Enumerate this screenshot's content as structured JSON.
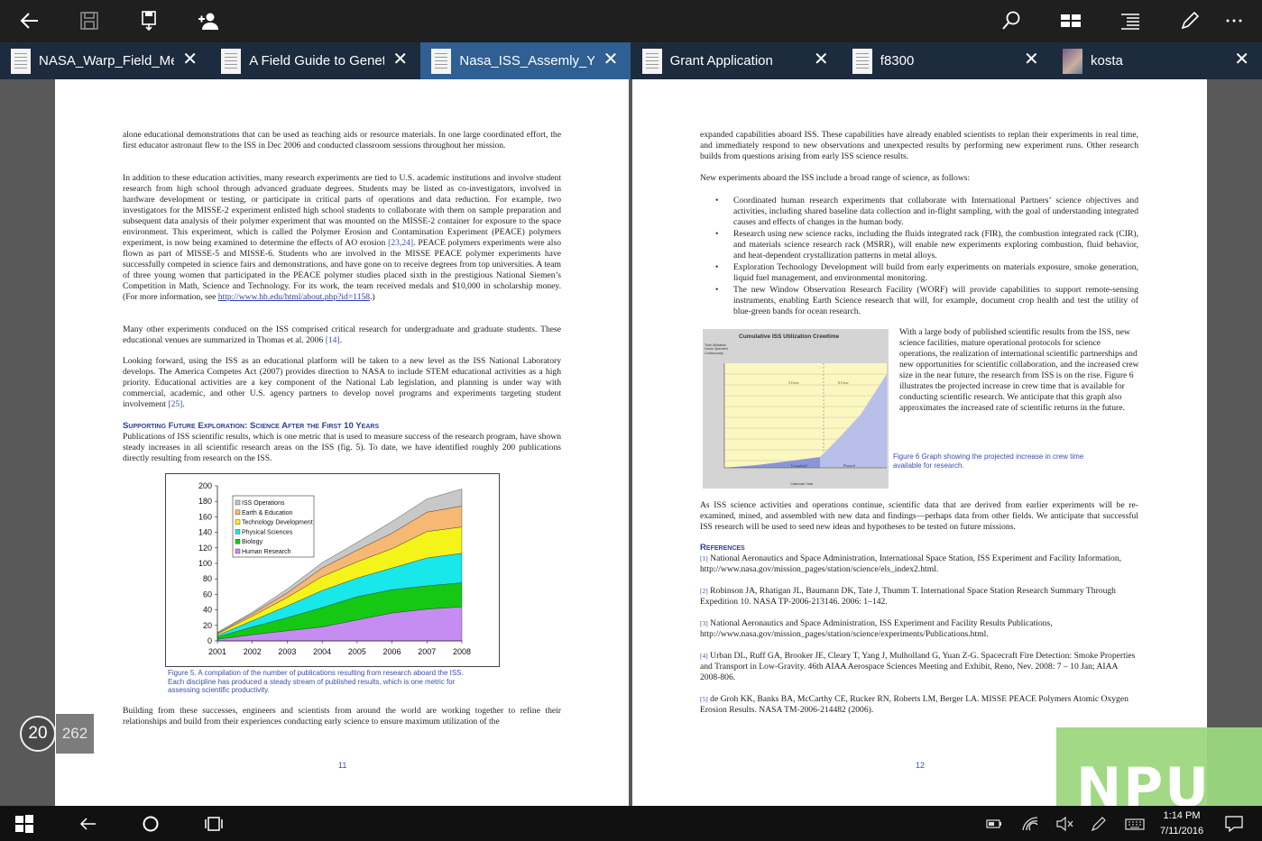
{
  "toolbar": {
    "buttons": [
      "back",
      "save",
      "save-as",
      "share-user",
      "search",
      "layout",
      "list",
      "pen",
      "more"
    ]
  },
  "tabs": [
    {
      "label": "NASA_Warp_Field_Me...",
      "active": false
    },
    {
      "label": "A Field Guide to Genet...",
      "active": false
    },
    {
      "label": "Nasa_ISS_Assemly_Years",
      "active": true
    },
    {
      "label": "Grant Application",
      "active": false
    },
    {
      "label": "f8300",
      "active": false
    },
    {
      "label": "kosta",
      "active": false
    }
  ],
  "tab_close": "✕",
  "left_page": {
    "p1": "alone educational demonstrations that can be used as teaching aids or resource materials. In one large coordinated effort, the first educator astronaut flew to the ISS in Dec 2006 and conducted classroom sessions throughout her mission.",
    "p2a": "In addition to these education activities, many research experiments are tied to U.S. academic institutions and involve student research from high school through advanced graduate degrees. Students may be listed as co-investigators, involved in hardware development or testing, or participate in critical parts of operations and data reduction. For example, two investigators for the MISSE-2 experiment enlisted high school students to collaborate with them on sample preparation and subsequent data analysis of their polymer experiment that was mounted on the MISSE-2 container for exposure to the space environment. This experiment, which is called the Polymer Erosion and Contamination Experiment (PEACE) polymers experiment, is now being examined to determine the effects of AO erosion",
    "p2ref": "[23,24]",
    "p2b": ". PEACE polymers experiments were also flown as part of MISSE-5 and MISSE-6. Students who are involved in the MISSE PEACE polymer experiments have successfully competed in science fairs and demonstrations, and have gone on to receive degrees from top universities. A team of three young women that participated in the PEACE polymer studies placed sixth in the prestigious National Siemen’s Competition in Math, Science and Technology. For its work, the team received medals and $10,000 in scholarship money. (For more information, see ",
    "p2link": "http://www.hb.edu/html/about.php?id=1158",
    "p2c": ".)",
    "p3a": "Many other experiments conduced on the ISS comprised critical research for undergraduate and graduate students. These educational venues are summarized in Thomas et al. 2006",
    "p3ref": "[14]",
    "p3b": ".",
    "p4a": "Looking forward, using the ISS as an educational platform will be taken to a new level as the ISS National Laboratory develops. The America Competes Act (2007) provides direction to NASA to include STEM educational activities as a high priority. Educational activities are a key component of the National Lab legislation, and planning is under way with commercial, academic, and other U.S. agency partners to develop novel programs and experiments targeting student involvement",
    "p4ref": "[25]",
    "p4b": ".",
    "heading": "Supporting Future Exploration: Science After the First 10 Years",
    "p5": "Publications of ISS scientific results, which is one metric that is used to measure success of the research program, have shown steady increases in all scientific research areas on the ISS (fig. 5). To date, we have identified roughly 200 publications directly resulting from research on the ISS.",
    "caption": "Figure 5. A compilation of the number of publications resulting from research aboard the ISS. Each discipline has produced a steady stream of published results, which is one metric for assessing scientific productivity.",
    "p6": "Building from these successes, engineers and scientists from around the world are working together to refine their relationships and build from their experiences conducting early science to ensure maximum utilization of the",
    "page_number": "11"
  },
  "right_page": {
    "p1": "expanded capabilities aboard ISS. These capabilities have already enabled scientists to replan their experiments in real time, and immediately respond to new observations and unexpected results by performing new experiment runs. Other research builds from questions arising from early ISS science results.",
    "p2": "New experiments aboard the ISS include a broad range of science, as follows:",
    "bullets": [
      "Coordinated human research experiments that collaborate with International Partners’ science objectives and activities, including shared baseline data collection and in-flight sampling, with the goal of understanding integrated causes and effects of changes in the human body.",
      "Research using new science racks, including the fluids integrated rack (FIR), the combustion integrated rack (CIR), and materials science research rack (MSRR), will enable new experiments exploring combustion, fluid behavior, and heat-dependent crystallization patterns in metal alloys.",
      "Exploration Technology Development will build from early experiments on materials exposure, smoke generation, liquid fuel management, and environmental monitoring.",
      "The new Window Observation Research Facility (WORF) will provide capabilities to support remote-sensing instruments, enabling Earth Science research that will, for example, document crop health and test the utility of blue-green bands for ocean research."
    ],
    "side_text": "With a large body of published scientific results from the ISS, new science facilities, mature operational protocols for science operations, the realization of international scientific partnerships and new opportunities for scientific collaboration, and the increased crew size in the near future, the research from ISS is on the rise. Figure 6 illustrates the projected increase in crew time that is available for conducting scientific research. We anticipate that this graph also approximates the increased rate of scientific returns in the future.",
    "fig6_title": "Cumulative ISS Utilization Crewtime",
    "fig6_ylabel": "Total Utilization Hours Operated Continuously",
    "fig6_labels": [
      "3 Crew",
      "6 Crew",
      "Completed",
      "Planned"
    ],
    "fig6_xlabel": "Calendar Year",
    "fig6_caption": "Figure 6 Graph showing the projected increase in crew time available for research.",
    "p3": "As ISS science activities and operations continue, scientific data that are derived from earlier experiments will be re-examined, mined, and assembled with new data and findings—perhaps data from other fields. We anticipate that successful ISS research will be used to seed new ideas and hypotheses to be tested on future missions.",
    "ref_heading": "References",
    "references": [
      {
        "n": "[1]",
        "t": "National Aeronautics and Space Administration, International Space Station, ISS Experiment and Facility Information, http://www.nasa.gov/mission_pages/station/science/els_index2.html."
      },
      {
        "n": "[2]",
        "t": "Robinson JA, Rhatigan JL, Baumann DK, Tate J, Thumm T. International Space Station Research Summary Through Expedition 10. NASA TP-2006-213146. 2006: 1–142."
      },
      {
        "n": "[3]",
        "t": "National Aeronautics and Space Administration, ISS Experiment and Facility Results Publications, http://www.nasa.gov/mission_pages/station/science/experiments/Publications.html."
      },
      {
        "n": "[4]",
        "t": "Urban DL, Ruff GA, Brooker JE, Cleary T, Yang J, Mulholland G, Yuan Z-G. Spacecraft Fire Detection: Smoke Properties and Transport in Low-Gravity. 46th AIAA Aerospace Sciences Meeting and Exhibit, Reno, Nev. 2008: 7 – 10 Jan; AIAA 2008-806."
      },
      {
        "n": "[5]",
        "t": "de Groh KK, Banks BA, McCarthy CE, Rucker RN, Roberts LM, Berger LA. MISSE PEACE Polymers Atomic Oxygen Erosion Results. NASA TM-2006-214482 (2006)."
      }
    ],
    "page_number": "12"
  },
  "page_counter": {
    "current": "20",
    "total": "262"
  },
  "watermark": "NPU",
  "clock": {
    "time": "1:14 PM",
    "date": "7/11/2016"
  },
  "chart_data": {
    "type": "area",
    "title": "",
    "x": [
      "2001",
      "2002",
      "2003",
      "2004",
      "2005",
      "2006",
      "2007",
      "2008"
    ],
    "ylim": [
      0,
      200
    ],
    "yticks": [
      0,
      20,
      40,
      60,
      80,
      100,
      120,
      140,
      160,
      180,
      200
    ],
    "legend_position": "top-left",
    "series": [
      {
        "name": "Human Research",
        "color": "#c58cf2",
        "values": [
          2,
          8,
          13,
          18,
          27,
          36,
          41,
          44
        ]
      },
      {
        "name": "Biology",
        "color": "#14c814",
        "values": [
          3,
          10,
          17,
          25,
          30,
          30,
          30,
          31
        ]
      },
      {
        "name": "Physical Sciences",
        "color": "#18e8ea",
        "values": [
          2,
          8,
          15,
          22,
          24,
          28,
          36,
          38
        ]
      },
      {
        "name": "Technology Development",
        "color": "#f4f41a",
        "values": [
          2,
          6,
          11,
          18,
          21,
          25,
          34,
          34
        ]
      },
      {
        "name": "Earth & Education",
        "color": "#f6b872",
        "values": [
          1,
          3,
          6,
          11,
          15,
          20,
          25,
          27
        ]
      },
      {
        "name": "ISS Operations",
        "color": "#c8c8c8",
        "values": [
          1,
          2,
          5,
          7,
          10,
          15,
          17,
          22
        ]
      }
    ]
  }
}
